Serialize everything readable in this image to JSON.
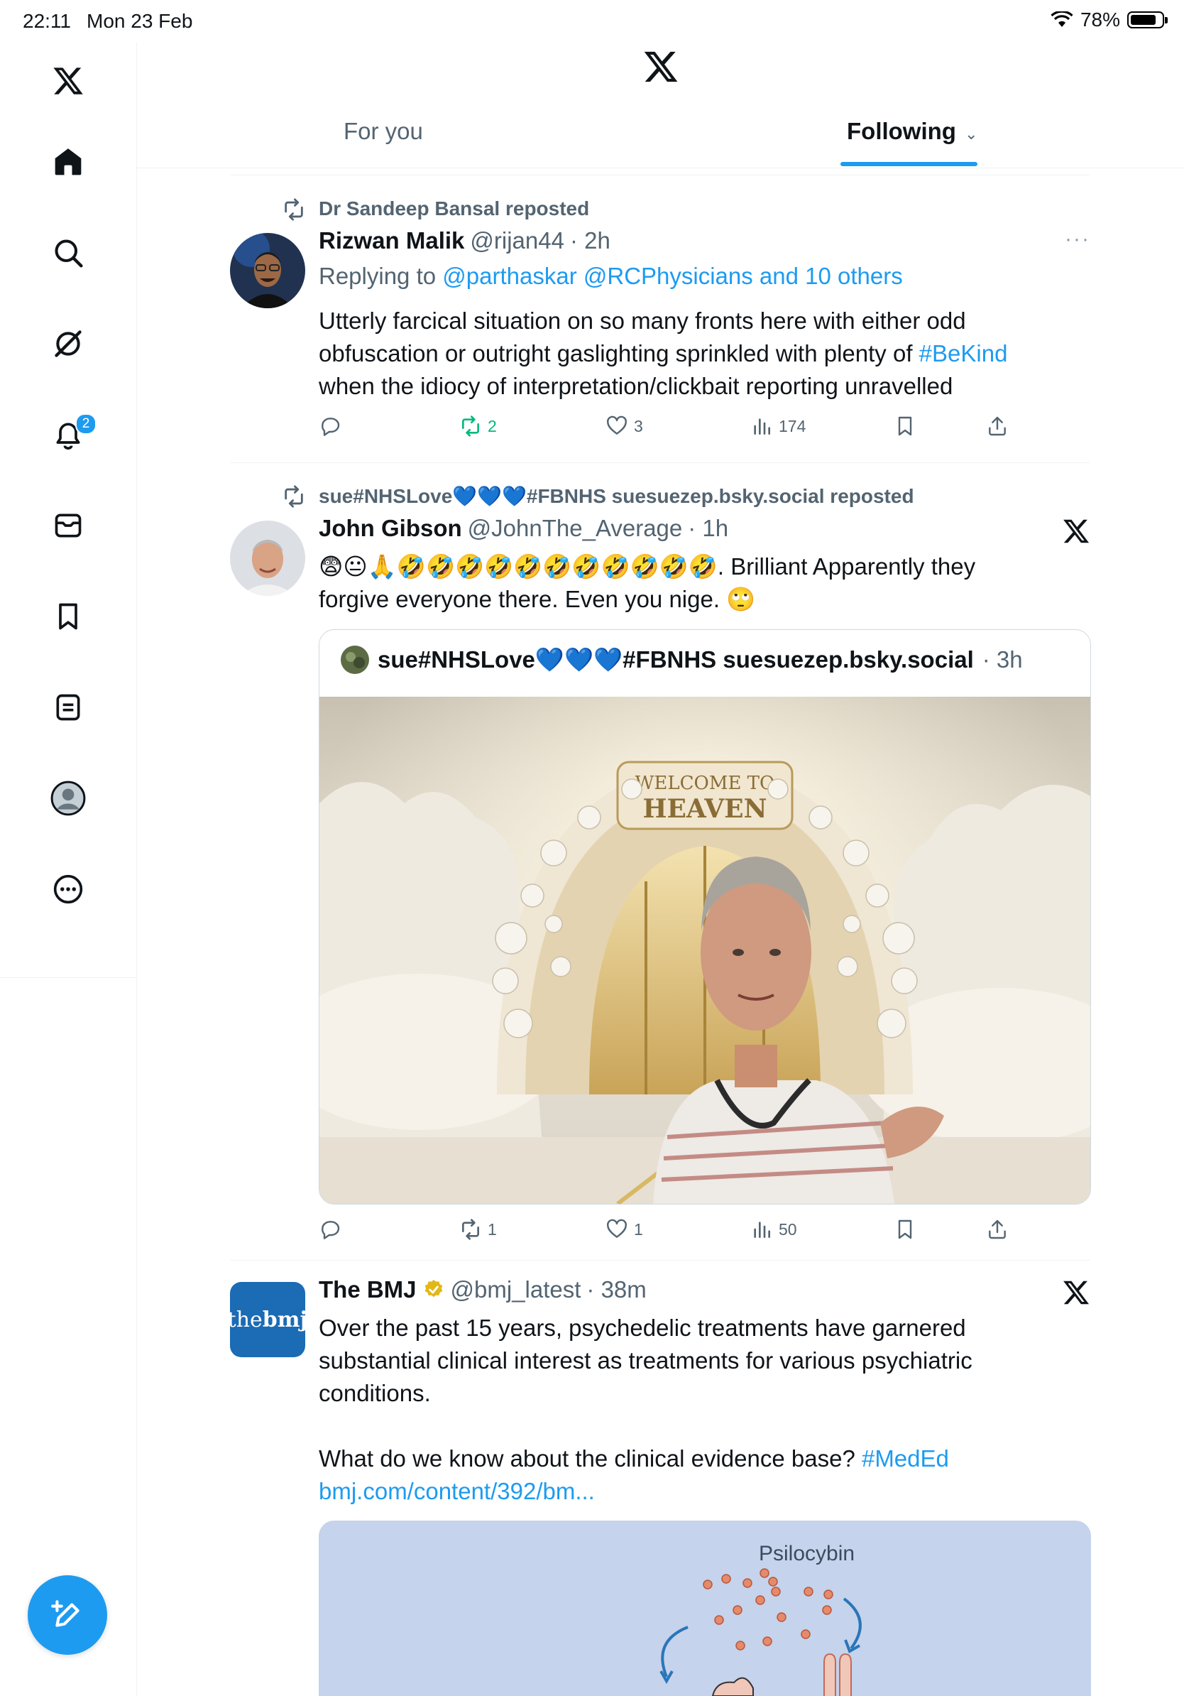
{
  "status_bar": {
    "time": "22:11",
    "date": "Mon 23 Feb",
    "battery": "78%"
  },
  "sidebar": {
    "items": [
      "logo",
      "home",
      "search",
      "grok",
      "notifications",
      "messages",
      "bookmarks",
      "lists",
      "profile",
      "more"
    ],
    "notification_count": "2"
  },
  "header": {
    "tabs": [
      {
        "label": "For you"
      },
      {
        "label": "Following"
      }
    ],
    "active_tab": "Following"
  },
  "posts": [
    {
      "repost_by": "Dr Sandeep Bansal reposted",
      "name": "Rizwan Malik",
      "handle": "@rijan44",
      "time": "· 2h",
      "replying_label": "Replying to",
      "replying_to": "@parthaskar @RCPhysicians and 10 others",
      "text_1": "Utterly farcical situation on so many fronts here with either odd",
      "text_2": "obfuscation or outright gaslighting sprinkled with plenty of ",
      "hashtag": "#BeKind",
      "text_3": "when the idiocy of interpretation/clickbait reporting unravelled",
      "more": "···",
      "stats": {
        "replies": "",
        "reposts": "2",
        "likes": "3",
        "views": "174"
      }
    },
    {
      "repost_by": "sue#NHSLove💙💙💙#FBNHS suesuezep.bsky.social reposted",
      "name": "John Gibson",
      "handle": "@JohnThe_Average",
      "time": "· 1h",
      "text_1": "😨😐🙏🤣🤣🤣🤣🤣🤣🤣🤣🤣🤣🤣.  Brilliant    Apparently they",
      "text_2": "forgive everyone there.  Even you nige. 🙄",
      "quote": {
        "name": "sue#NHSLove💙💙💙#FBNHS suesuezep.bsky.social",
        "time": "· 3h",
        "image_sign_line1": "WELCOME TO",
        "image_sign_line2": "HEAVEN"
      },
      "stats": {
        "replies": "",
        "reposts": "1",
        "likes": "1",
        "views": "50"
      }
    },
    {
      "name": "The BMJ",
      "handle": "@bmj_latest",
      "time": "· 38m",
      "avatar_text_1": "the",
      "avatar_text_2": "bmj",
      "text_1": "Over the past 15 years, psychedelic treatments have garnered",
      "text_2": "substantial clinical interest as treatments for various psychiatric",
      "text_3": "conditions.",
      "text_4": "What do we know about the clinical evidence base? ",
      "hashtag": "#MedEd",
      "link": "bmj.com/content/392/bm...",
      "card_label": "Psilocybin"
    }
  ],
  "colors": {
    "accent": "#1d9bf0",
    "repost_green": "#00ba7c",
    "text": "#0f1419",
    "secondary": "#536471",
    "verified_gold": "#e2b719",
    "bmj_blue": "#1b6bb5"
  }
}
